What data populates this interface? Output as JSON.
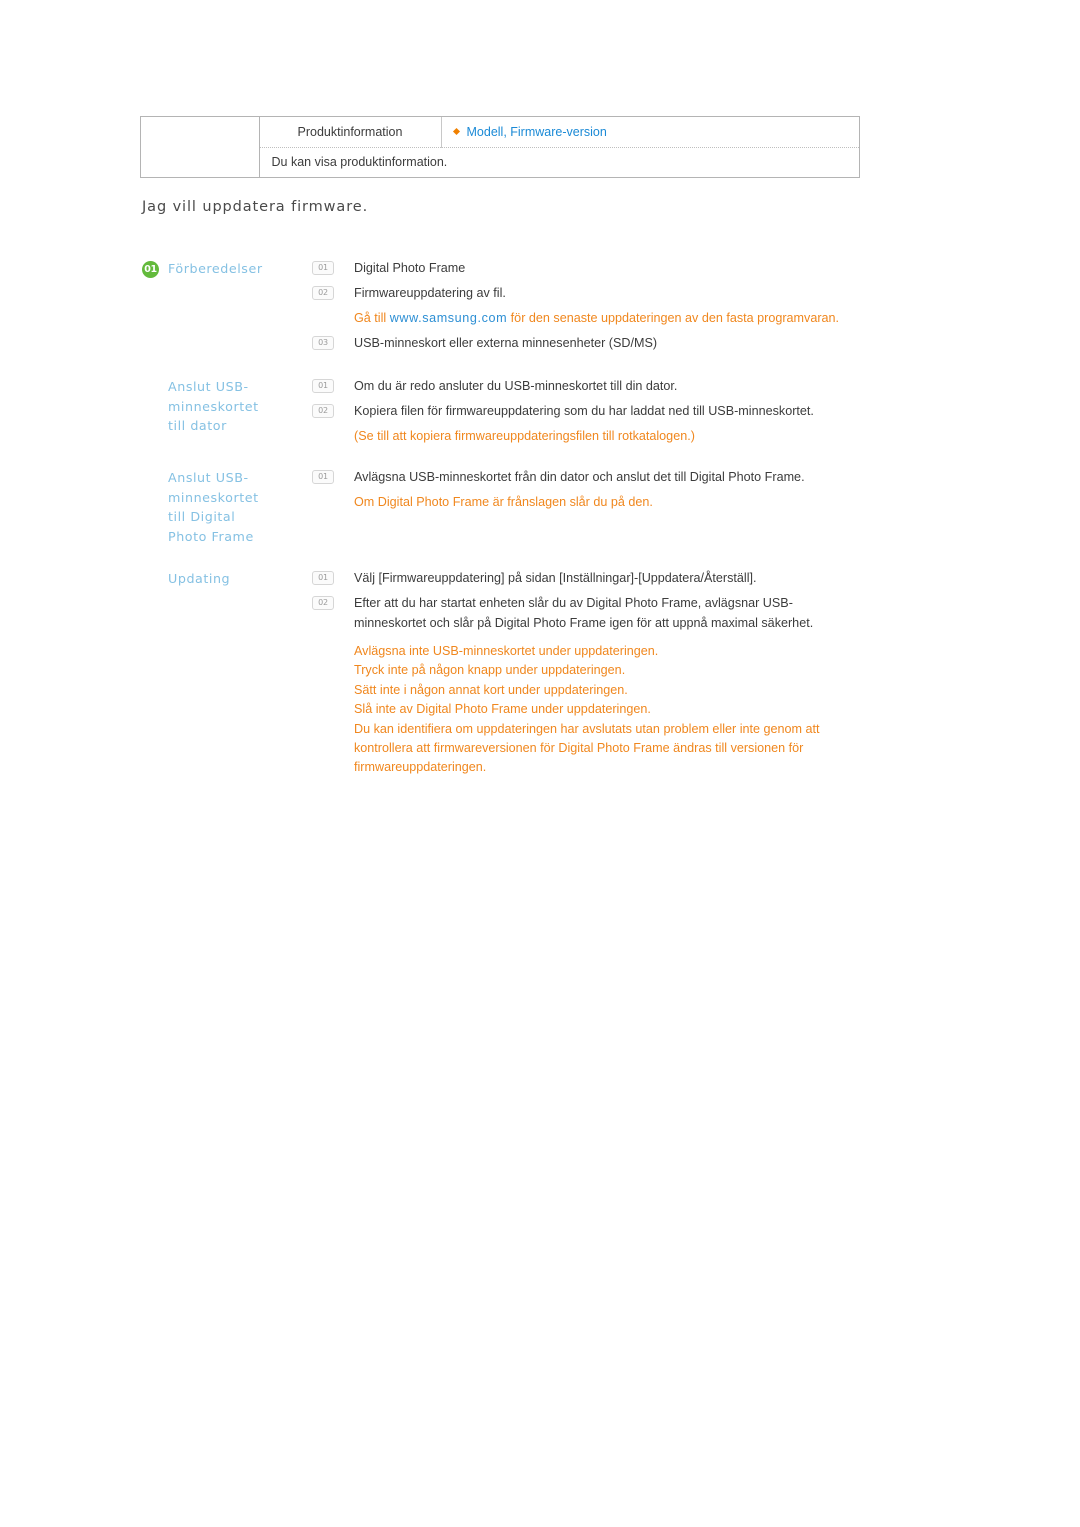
{
  "document": {
    "heading": "Jag vill uppdatera firmware."
  },
  "info_table": {
    "label": "Produktinformation",
    "value": "Modell, Firmware-version",
    "bullet_icon": "diamond-bullet-icon",
    "description": "Du kan visa produktinformation."
  },
  "sections": [
    {
      "badge": "01",
      "title": "Förberedelser",
      "title_lines": [
        "Förberedelser"
      ],
      "steps": [
        {
          "num": "01",
          "text": "Digital Photo Frame"
        },
        {
          "num": "02",
          "text": "Firmwareuppdatering av fil."
        }
      ],
      "note_pre": "Gå till ",
      "note_link": "www.samsung.com",
      "note_post": " för den senaste uppdateringen av den fasta programvaran.",
      "steps_after": [
        {
          "num": "03",
          "text": "USB-minneskort eller externa minnesenheter (SD/MS)"
        }
      ]
    },
    {
      "title_lines": [
        "Anslut USB-",
        "minneskortet",
        "till dator"
      ],
      "steps": [
        {
          "num": "01",
          "text": "Om du är redo ansluter du USB-minneskortet till din dator."
        },
        {
          "num": "02",
          "text": "Kopiera filen för firmwareuppdatering som du har laddat ned till USB-minneskortet."
        }
      ],
      "note": "(Se till att kopiera firmwareuppdateringsfilen till rotkatalogen.)"
    },
    {
      "title_lines": [
        "Anslut USB-",
        "minneskortet",
        "till Digital",
        "Photo Frame"
      ],
      "steps": [
        {
          "num": "01",
          "text": "Avlägsna USB-minneskortet från din dator och anslut det till Digital Photo Frame."
        }
      ],
      "note": "Om Digital Photo Frame är frånslagen slår du på den."
    },
    {
      "title_lines": [
        "Updating"
      ],
      "steps": [
        {
          "num": "01",
          "text": "Välj [Firmwareuppdatering] på sidan [Inställningar]-[Uppdatera/Återställ]."
        },
        {
          "num": "02",
          "text": "Efter att du har startat enheten slår du av Digital Photo Frame, avlägsnar USB-minneskortet och slår på Digital Photo Frame igen för att uppnå maximal säkerhet."
        }
      ],
      "warnings": [
        "Avlägsna inte USB-minneskortet under uppdateringen.",
        "Tryck inte på någon knapp under uppdateringen.",
        "Sätt inte i någon annat kort under uppdateringen.",
        "Slå inte av Digital Photo Frame under uppdateringen.",
        "Du kan identifiera om uppdateringen har avslutats utan problem eller inte genom att",
        "kontrollera att firmwareversionen för Digital Photo Frame ändras till versionen för",
        "firmwareuppdateringen."
      ]
    }
  ],
  "colors": {
    "orange": "#f0871e",
    "blue_link": "#1b8ad6",
    "blue_title": "#85c1e3",
    "green_badge": "#63ba3c",
    "body_text": "#3c3c3c",
    "table_border": "#b4b4b4"
  }
}
